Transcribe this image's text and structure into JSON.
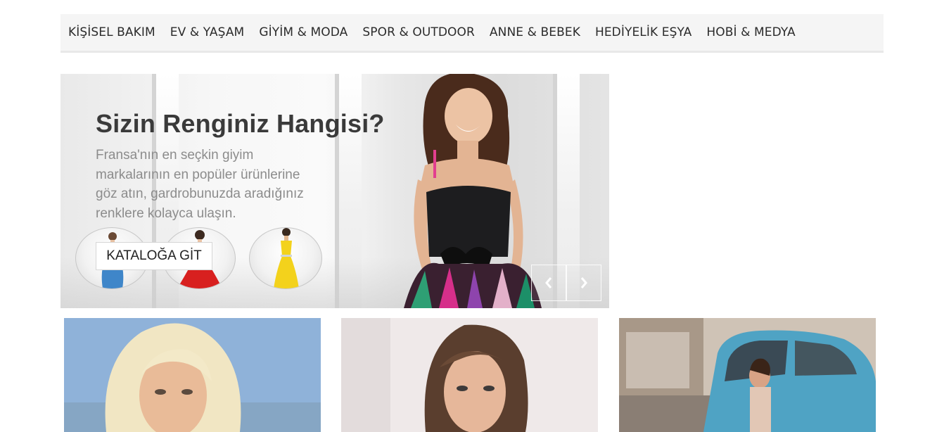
{
  "nav": {
    "items": [
      {
        "label": "KİŞİSEL BAKIM",
        "name": "nav-item-kisisel-bakim"
      },
      {
        "label": "EV & YAŞAM",
        "name": "nav-item-ev-yasam"
      },
      {
        "label": "GİYİM & MODA",
        "name": "nav-item-giyim-moda"
      },
      {
        "label": "SPOR & OUTDOOR",
        "name": "nav-item-spor-outdoor"
      },
      {
        "label": "ANNE & BEBEK",
        "name": "nav-item-anne-bebek"
      },
      {
        "label": "HEDİYELİK EŞYA",
        "name": "nav-item-hediyelik-esya"
      },
      {
        "label": "HOBİ & MEDYA",
        "name": "nav-item-hobi-medya"
      }
    ]
  },
  "hero": {
    "title": "Sizin Renginiz Hangisi?",
    "text_lines": [
      "Fransa'nın en seçkin giyim",
      "markalarının en popüler ürünlerine",
      "göz atın, gardrobunuzda aradığınız",
      "renklere kolayca ulaşın."
    ],
    "button_label": "KATALOĞA GİT",
    "thumbnails": [
      {
        "name": "blue-dress-thumbnail",
        "color": "#3f86c9"
      },
      {
        "name": "red-dress-thumbnail",
        "color": "#d8201f"
      },
      {
        "name": "yellow-dress-thumbnail",
        "color": "#f3d21c"
      }
    ],
    "prev_icon": "chevron-left-icon",
    "next_icon": "chevron-right-icon"
  },
  "products": [
    {
      "name": "product-card-blonde-model"
    },
    {
      "name": "product-card-brunette-model"
    },
    {
      "name": "product-card-vintage-car-model"
    }
  ],
  "colors": {
    "nav_background": "#f5f5f5",
    "nav_text": "#2b2b2b",
    "hero_title": "#3a3a3a",
    "hero_text": "#8c8c8c"
  }
}
